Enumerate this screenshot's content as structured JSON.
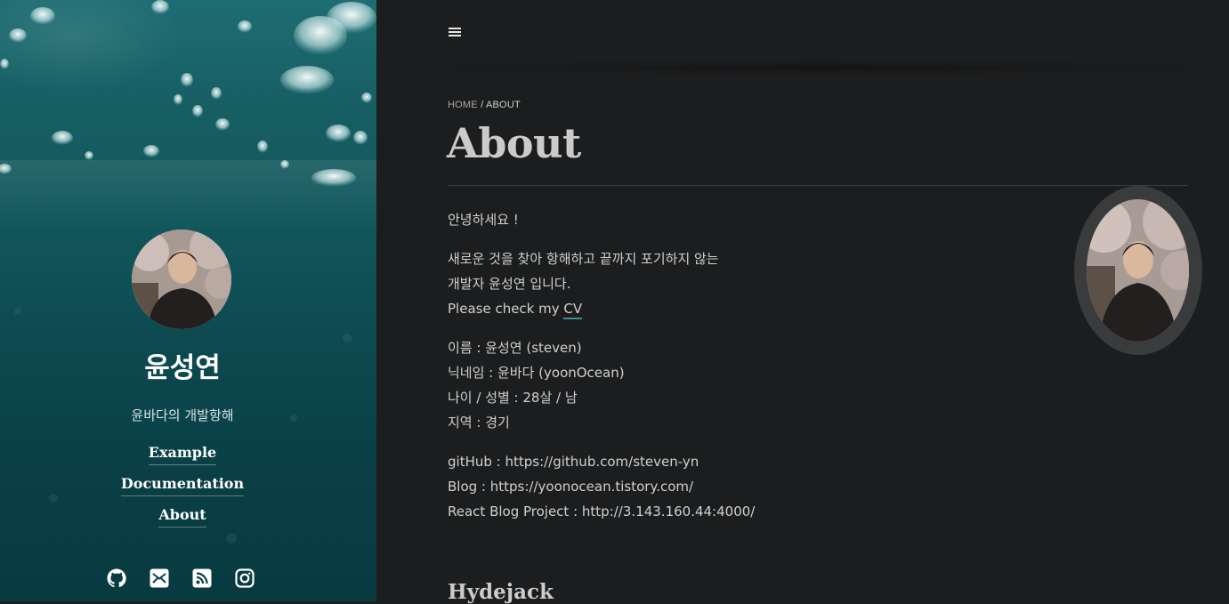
{
  "sidebar": {
    "name": "윤성연",
    "tagline": "윤바다의 개발항해",
    "nav": [
      {
        "label": "Example"
      },
      {
        "label": "Documentation"
      },
      {
        "label": "About"
      }
    ],
    "social_icons": [
      "github-icon",
      "mail-icon",
      "rss-icon",
      "instagram-icon"
    ],
    "accent": "#12585d"
  },
  "header": {
    "menu_icon": "hamburger-icon"
  },
  "breadcrumb": {
    "home": "HOME",
    "separator": " / ",
    "current": "ABOUT"
  },
  "page": {
    "title": "About",
    "greeting": "안녕하세요 !",
    "intro_line1": "새로운 것을 찾아 항해하고 끝까지 포기하지 않는",
    "intro_line2": "개발자 윤성연 입니다.",
    "cv_prefix": "Please check my ",
    "cv_link": "CV",
    "name_line": "이름 : 윤성연 (steven)",
    "nickname_line": "닉네임 : 윤바다 (yoonOcean)",
    "age_line": "나이 / 성별 : 28살 / 남",
    "region_line": "지역 : 경기",
    "github_line": "gitHub : https://github.com/steven-yn",
    "blog_line": "Blog : https://yoonocean.tistory.com/",
    "react_line": "React Blog Project : http://3.143.160.44:4000/",
    "section_heading": "Hydejack"
  },
  "colors": {
    "background": "#1c1d1e",
    "text": "#d0d0d0",
    "link_underline": "#3f8e93"
  }
}
